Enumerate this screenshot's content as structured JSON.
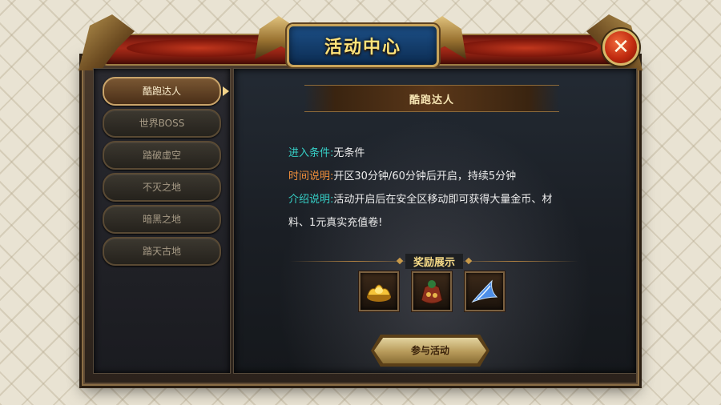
{
  "window": {
    "title": "活动中心",
    "close_symbol": "✕"
  },
  "menu": {
    "items": [
      {
        "label": "酷跑达人",
        "active": true
      },
      {
        "label": "世界BOSS",
        "active": false
      },
      {
        "label": "踏破虚空",
        "active": false
      },
      {
        "label": "不灭之地",
        "active": false
      },
      {
        "label": "暗黑之地",
        "active": false
      },
      {
        "label": "踏天古地",
        "active": false
      }
    ]
  },
  "detail": {
    "title": "酷跑达人",
    "entry_label": "进入条件:",
    "entry_value": "无条件",
    "time_label": "时间说明:",
    "time_value": "开区30分钟/60分钟后开启，持续5分钟",
    "intro_label": "介绍说明:",
    "intro_value_line1": "活动开启后在安全区移动即可获得大量金币、材",
    "intro_value_line2": "料、1元真实充值卷!",
    "reward_title": "奖励展示",
    "rewards": [
      {
        "icon": "gold-ingot-icon"
      },
      {
        "icon": "treasure-bag-icon"
      },
      {
        "icon": "blue-crystal-icon"
      }
    ],
    "join_label": "参与活动"
  },
  "colors": {
    "cyan_label": "#36d0c7",
    "orange_label": "#f08f3b",
    "gold_text": "#f7dc88"
  }
}
